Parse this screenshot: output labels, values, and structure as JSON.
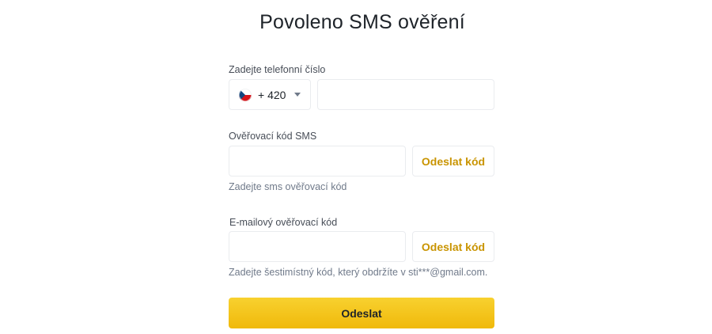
{
  "page": {
    "title": "Povoleno SMS ověření"
  },
  "phone": {
    "label": "Zadejte telefonní číslo",
    "country_code": "+ 420",
    "country_flag": "czech-flag-icon",
    "value": ""
  },
  "sms": {
    "label": "Ověřovací kód SMS",
    "value": "",
    "send_label": "Odeslat kód",
    "hint": "Zadejte sms ověřovací kód"
  },
  "email": {
    "label": "E-mailový ověřovací kód",
    "value": "",
    "send_label": "Odeslat kód",
    "hint": "Zadejte šestimístný kód, který obdržíte v sti***@gmail.com."
  },
  "submit": {
    "label": "Odeslat"
  },
  "colors": {
    "accent": "#f0b90b",
    "link": "#c99400",
    "border": "#eaecef",
    "text": "#1e2329",
    "muted": "#707a8a"
  }
}
